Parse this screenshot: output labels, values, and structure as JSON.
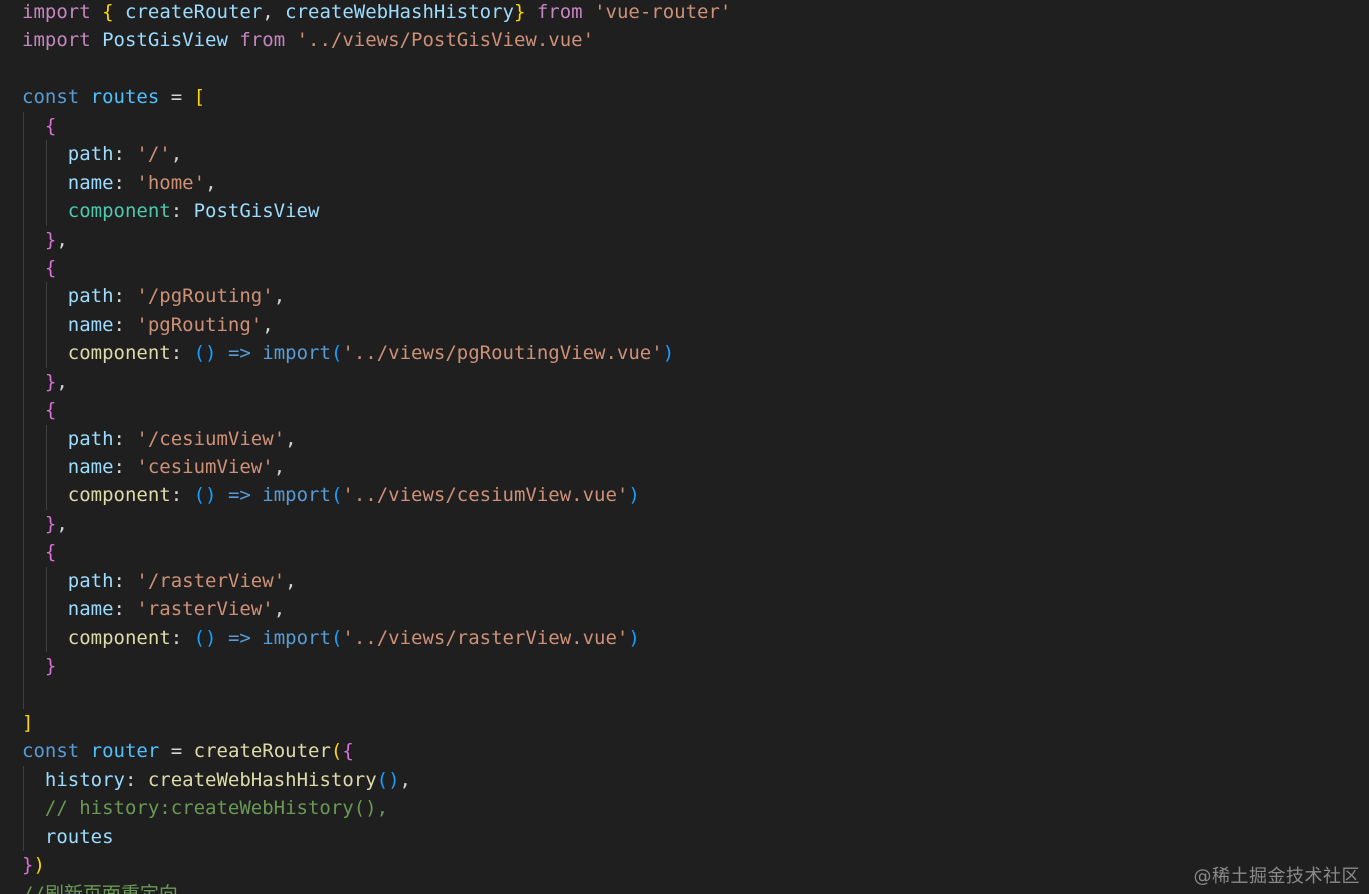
{
  "editor": {
    "theme_colors": {
      "background": "#1f1f1f",
      "keyword_import": "#c586c0",
      "keyword_decl": "#569cd6",
      "identifier": "#9cdcfe",
      "function": "#dcdcaa",
      "string": "#ce9178",
      "comment": "#6a9955",
      "bracket_level1": "#ffd700",
      "bracket_level2": "#da70d6",
      "bracket_level3": "#179fff"
    },
    "lines": [
      {
        "guides": 0,
        "tokens": [
          {
            "t": "import",
            "c": "kw"
          },
          {
            "t": " "
          },
          {
            "t": "{",
            "c": "b1"
          },
          {
            "t": " "
          },
          {
            "t": "createRouter",
            "c": "id"
          },
          {
            "t": ", "
          },
          {
            "t": "createWebHashHistory",
            "c": "id"
          },
          {
            "t": "}",
            "c": "b1"
          },
          {
            "t": " "
          },
          {
            "t": "from",
            "c": "kw"
          },
          {
            "t": " "
          },
          {
            "t": "'vue-router'",
            "c": "str"
          }
        ]
      },
      {
        "guides": 0,
        "tokens": [
          {
            "t": "import",
            "c": "kw"
          },
          {
            "t": " "
          },
          {
            "t": "PostGisView",
            "c": "id"
          },
          {
            "t": " "
          },
          {
            "t": "from",
            "c": "kw"
          },
          {
            "t": " "
          },
          {
            "t": "'../views/PostGisView.vue'",
            "c": "str"
          }
        ]
      },
      {
        "guides": 0,
        "tokens": []
      },
      {
        "guides": 0,
        "tokens": [
          {
            "t": "const",
            "c": "kwb"
          },
          {
            "t": " "
          },
          {
            "t": "routes",
            "c": "const"
          },
          {
            "t": " = "
          },
          {
            "t": "[",
            "c": "b1"
          }
        ]
      },
      {
        "guides": 1,
        "tokens": [
          {
            "t": "  "
          },
          {
            "t": "{",
            "c": "b2"
          }
        ]
      },
      {
        "guides": 2,
        "tokens": [
          {
            "t": "    "
          },
          {
            "t": "path",
            "c": "prop"
          },
          {
            "t": ": "
          },
          {
            "t": "'/'",
            "c": "str"
          },
          {
            "t": ","
          }
        ]
      },
      {
        "guides": 2,
        "tokens": [
          {
            "t": "    "
          },
          {
            "t": "name",
            "c": "prop"
          },
          {
            "t": ": "
          },
          {
            "t": "'home'",
            "c": "str"
          },
          {
            "t": ","
          }
        ]
      },
      {
        "guides": 2,
        "tokens": [
          {
            "t": "    "
          },
          {
            "t": "component",
            "c": "prop-green"
          },
          {
            "t": ": "
          },
          {
            "t": "PostGisView",
            "c": "id"
          }
        ]
      },
      {
        "guides": 1,
        "tokens": [
          {
            "t": "  "
          },
          {
            "t": "}",
            "c": "b2"
          },
          {
            "t": ","
          }
        ]
      },
      {
        "guides": 1,
        "tokens": [
          {
            "t": "  "
          },
          {
            "t": "{",
            "c": "b2"
          }
        ]
      },
      {
        "guides": 2,
        "tokens": [
          {
            "t": "    "
          },
          {
            "t": "path",
            "c": "prop"
          },
          {
            "t": ": "
          },
          {
            "t": "'/pgRouting'",
            "c": "str"
          },
          {
            "t": ","
          }
        ]
      },
      {
        "guides": 2,
        "tokens": [
          {
            "t": "    "
          },
          {
            "t": "name",
            "c": "prop"
          },
          {
            "t": ": "
          },
          {
            "t": "'pgRouting'",
            "c": "str"
          },
          {
            "t": ","
          }
        ]
      },
      {
        "guides": 2,
        "tokens": [
          {
            "t": "    "
          },
          {
            "t": "component",
            "c": "fn"
          },
          {
            "t": ": "
          },
          {
            "t": "()",
            "c": "b3"
          },
          {
            "t": " "
          },
          {
            "t": "=>",
            "c": "kwb"
          },
          {
            "t": " "
          },
          {
            "t": "import",
            "c": "kwb"
          },
          {
            "t": "(",
            "c": "b3"
          },
          {
            "t": "'../views/pgRoutingView.vue'",
            "c": "str"
          },
          {
            "t": ")",
            "c": "b3"
          }
        ]
      },
      {
        "guides": 1,
        "tokens": [
          {
            "t": "  "
          },
          {
            "t": "}",
            "c": "b2"
          },
          {
            "t": ","
          }
        ]
      },
      {
        "guides": 1,
        "tokens": [
          {
            "t": "  "
          },
          {
            "t": "{",
            "c": "b2"
          }
        ]
      },
      {
        "guides": 2,
        "tokens": [
          {
            "t": "    "
          },
          {
            "t": "path",
            "c": "prop"
          },
          {
            "t": ": "
          },
          {
            "t": "'/cesiumView'",
            "c": "str"
          },
          {
            "t": ","
          }
        ]
      },
      {
        "guides": 2,
        "tokens": [
          {
            "t": "    "
          },
          {
            "t": "name",
            "c": "prop"
          },
          {
            "t": ": "
          },
          {
            "t": "'cesiumView'",
            "c": "str"
          },
          {
            "t": ","
          }
        ]
      },
      {
        "guides": 2,
        "tokens": [
          {
            "t": "    "
          },
          {
            "t": "component",
            "c": "fn"
          },
          {
            "t": ": "
          },
          {
            "t": "()",
            "c": "b3"
          },
          {
            "t": " "
          },
          {
            "t": "=>",
            "c": "kwb"
          },
          {
            "t": " "
          },
          {
            "t": "import",
            "c": "kwb"
          },
          {
            "t": "(",
            "c": "b3"
          },
          {
            "t": "'../views/cesiumView.vue'",
            "c": "str"
          },
          {
            "t": ")",
            "c": "b3"
          }
        ]
      },
      {
        "guides": 1,
        "tokens": [
          {
            "t": "  "
          },
          {
            "t": "}",
            "c": "b2"
          },
          {
            "t": ","
          }
        ]
      },
      {
        "guides": 1,
        "tokens": [
          {
            "t": "  "
          },
          {
            "t": "{",
            "c": "b2"
          }
        ]
      },
      {
        "guides": 2,
        "tokens": [
          {
            "t": "    "
          },
          {
            "t": "path",
            "c": "prop"
          },
          {
            "t": ": "
          },
          {
            "t": "'/rasterView'",
            "c": "str"
          },
          {
            "t": ","
          }
        ]
      },
      {
        "guides": 2,
        "tokens": [
          {
            "t": "    "
          },
          {
            "t": "name",
            "c": "prop"
          },
          {
            "t": ": "
          },
          {
            "t": "'rasterView'",
            "c": "str"
          },
          {
            "t": ","
          }
        ]
      },
      {
        "guides": 2,
        "tokens": [
          {
            "t": "    "
          },
          {
            "t": "component",
            "c": "fn"
          },
          {
            "t": ": "
          },
          {
            "t": "()",
            "c": "b3"
          },
          {
            "t": " "
          },
          {
            "t": "=>",
            "c": "kwb"
          },
          {
            "t": " "
          },
          {
            "t": "import",
            "c": "kwb"
          },
          {
            "t": "(",
            "c": "b3"
          },
          {
            "t": "'../views/rasterView.vue'",
            "c": "str"
          },
          {
            "t": ")",
            "c": "b3"
          }
        ]
      },
      {
        "guides": 1,
        "tokens": [
          {
            "t": "  "
          },
          {
            "t": "}",
            "c": "b2"
          }
        ]
      },
      {
        "guides": 1,
        "tokens": []
      },
      {
        "guides": 0,
        "tokens": [
          {
            "t": "]",
            "c": "b1"
          }
        ]
      },
      {
        "guides": 0,
        "tokens": [
          {
            "t": "const",
            "c": "kwb"
          },
          {
            "t": " "
          },
          {
            "t": "router",
            "c": "const"
          },
          {
            "t": " = "
          },
          {
            "t": "createRouter",
            "c": "fn"
          },
          {
            "t": "(",
            "c": "b1"
          },
          {
            "t": "{",
            "c": "b2"
          }
        ]
      },
      {
        "guides": 1,
        "tokens": [
          {
            "t": "  "
          },
          {
            "t": "history",
            "c": "prop"
          },
          {
            "t": ": "
          },
          {
            "t": "createWebHashHistory",
            "c": "fn"
          },
          {
            "t": "()",
            "c": "b3"
          },
          {
            "t": ","
          }
        ]
      },
      {
        "guides": 1,
        "tokens": [
          {
            "t": "  "
          },
          {
            "t": "// history:createWebHistory(),",
            "c": "cmt"
          }
        ]
      },
      {
        "guides": 1,
        "tokens": [
          {
            "t": "  "
          },
          {
            "t": "routes",
            "c": "prop"
          }
        ]
      },
      {
        "guides": 0,
        "tokens": [
          {
            "t": "}",
            "c": "b2"
          },
          {
            "t": ")",
            "c": "b1"
          }
        ]
      },
      {
        "guides": 0,
        "tokens": [
          {
            "t": "//刷新页面重定向",
            "c": "cmt"
          }
        ]
      }
    ]
  },
  "watermark": "@稀土掘金技术社区"
}
